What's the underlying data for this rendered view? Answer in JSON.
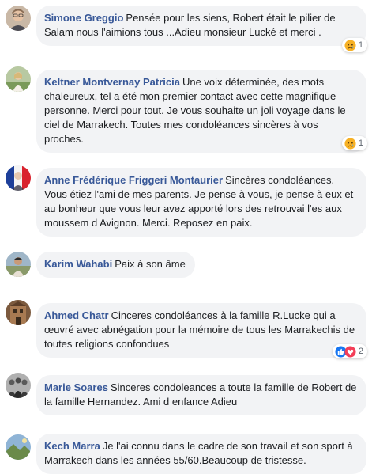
{
  "comments": [
    {
      "author": "Simone Greggio",
      "text": "Pensée pour les siens, Robert était le pilier de Salam nous l'aimions tous ...Adieu monsieur Lucké et merci .",
      "avatar": "avatar-woman-glasses",
      "reaction_count": "1",
      "reaction_icons": [
        "sad-reaction-icon"
      ]
    },
    {
      "author": "Keltner Montvernay Patricia",
      "text": "Une voix déterminée, des mots chaleureux, tel a été mon premier contact avec cette magnifique personne. Merci pour tout. Je vous souhaite un joli voyage dans le ciel de Marrakech. Toutes mes condoléances sincères à vos proches.",
      "avatar": "avatar-woman-outdoors",
      "reaction_count": "1",
      "reaction_icons": [
        "sad-reaction-icon"
      ]
    },
    {
      "author": "Anne Frédérique Friggeri Montaurier",
      "text": "Sincères condoléances. Vous étiez l'ami de mes parents. Je pense à vous, je pense à eux et au bonheur que vous leur avez apporté lors des retrouvai l'es aux moussem d Avignon. Merci. Reposez en paix.",
      "avatar": "avatar-flag-portrait"
    },
    {
      "author": "Karim Wahabi",
      "text": "Paix à son âme",
      "avatar": "avatar-person-outdoors"
    },
    {
      "author": "Ahmed Chatr",
      "text": "Cinceres condoléances à la famille R.Lucke qui a œuvré avec abnégation pour la mémoire de tous les Marrakechis de toutes religions confondues",
      "avatar": "avatar-building",
      "reaction_count": "2",
      "reaction_icons": [
        "like-reaction-icon",
        "love-reaction-icon"
      ]
    },
    {
      "author": "Marie Soares",
      "text": "Sinceres condoleances a toute la famille de Robert de la famille Hernandez. Ami d enfance Adieu",
      "avatar": "avatar-group-photo"
    },
    {
      "author": "Kech Marra",
      "text": "Je l'ai connu dans le cadre de son travail et son sport à Marrakech dans les années 55/60.Beaucoup de tristesse.",
      "avatar": "avatar-landscape"
    }
  ],
  "colors": {
    "author": "#385898",
    "bubble": "#f2f3f5",
    "text": "#1c1e21",
    "like": "#1877f2",
    "love": "#f33e58",
    "sad": "#f7b125"
  }
}
